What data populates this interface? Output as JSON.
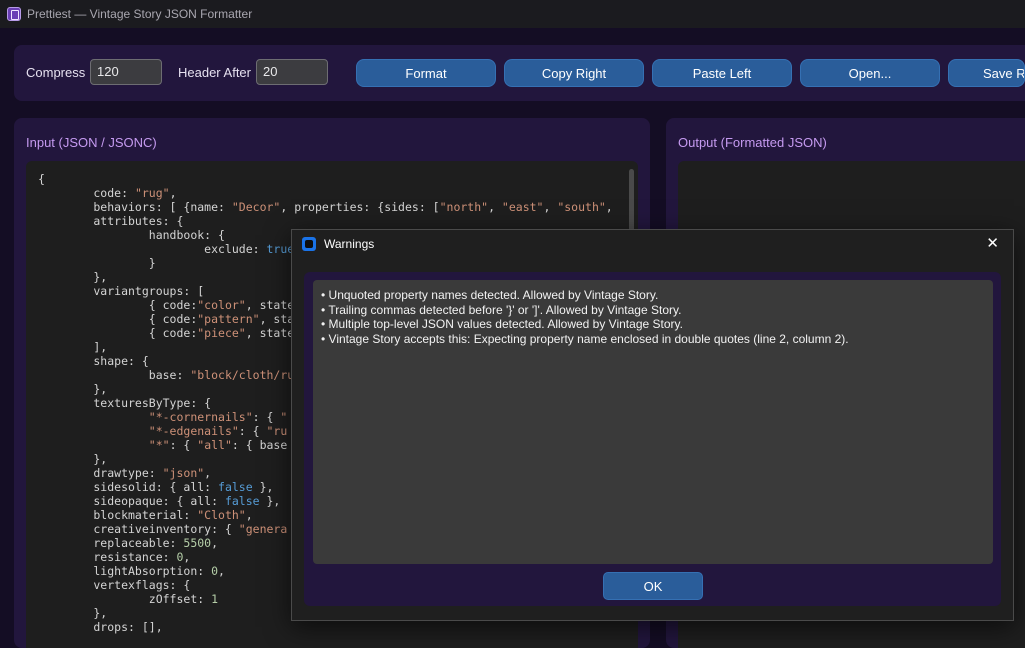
{
  "window": {
    "title": "Prettiest — Vintage Story JSON Formatter"
  },
  "toolbar": {
    "compress_label": "Compress",
    "compress_value": "120",
    "header_after_label": "Header After",
    "header_after_value": "20",
    "format_label": "Format",
    "copy_right_label": "Copy Right",
    "paste_left_label": "Paste Left",
    "open_label": "Open...",
    "save_right_label": "Save Ri"
  },
  "input_panel": {
    "title": "Input (JSON / JSONC)"
  },
  "output_panel": {
    "title": "Output (Formatted JSON)"
  },
  "dialog": {
    "title": "Warnings",
    "close_glyph": "✕",
    "warnings": [
      "• Unquoted property names detected. Allowed by Vintage Story.",
      "• Trailing commas detected before '}' or ']'. Allowed by Vintage Story.",
      "• Multiple top-level JSON values detected. Allowed by Vintage Story.",
      "• Vintage Story accepts this: Expecting property name enclosed in double quotes (line 2, column 2)."
    ],
    "ok_label": "OK"
  },
  "colors": {
    "background": "#140d24",
    "panel": "#22163d",
    "accent_button": "#2a5d9a",
    "panel_title": "#c59af0",
    "editor": "#1e1e1e"
  },
  "icons": {
    "app": "document-icon",
    "dialog": "window-icon",
    "close": "close-icon"
  }
}
